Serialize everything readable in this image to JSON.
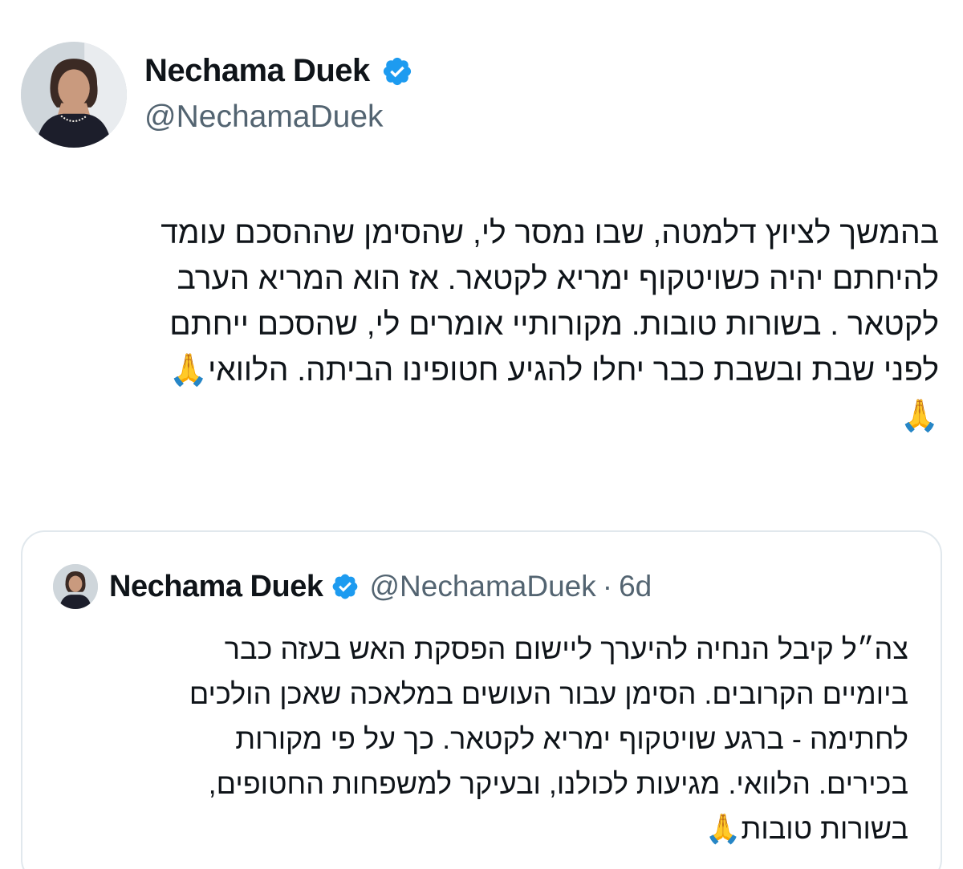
{
  "author": {
    "display_name": "Nechama Duek",
    "handle": "@NechamaDuek",
    "verified": true
  },
  "tweet": {
    "text_lines": [
      "בהמשך לציוץ דלמטה, שבו נמסר לי, שהסימן שההסכם עומד",
      "להיחתם יהיה כשויטקוף ימריא לקטאר. אז הוא המריא הערב",
      "לקטאר . בשורות טובות. מקורותיי אומרים לי, שהסכם ייחתם",
      "לפני שבת ובשבת כבר יחלו להגיע חטופינו הביתה. הלוואי🙏",
      "🙏"
    ]
  },
  "quoted_tweet": {
    "display_name": "Nechama Duek",
    "handle": "@NechamaDuek",
    "separator": "·",
    "time": "6d",
    "verified": true,
    "text_lines": [
      "צה״ל קיבל הנחיה להיערך ליישום הפסקת האש בעזה כבר",
      "ביומיים הקרובים. הסימן עבור העושים במלאכה שאכן הולכים",
      "לחתימה - ברגע שויטקוף ימריא לקטאר. כך על פי מקורות",
      "בכירים. הלוואי. מגיעות לכולנו, ובעיקר למשפחות החטופים,",
      "בשורות טובות🙏"
    ]
  },
  "icons": {
    "verified": "verified-badge-icon",
    "pray": "folded-hands-emoji"
  },
  "colors": {
    "verified_blue": "#1d9bf0",
    "text_primary": "#0f1419",
    "text_secondary": "#536471",
    "card_border": "#e1e8ed"
  }
}
